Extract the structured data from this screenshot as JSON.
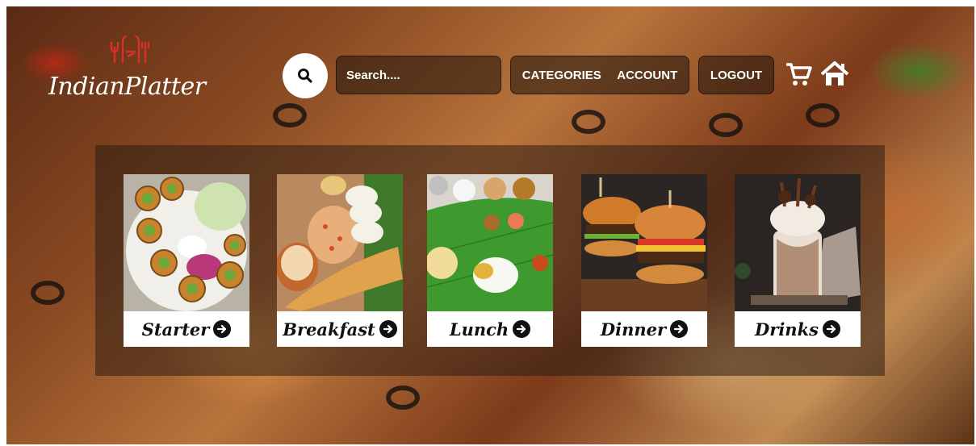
{
  "brand": {
    "name": "IndianPlatter",
    "accent": "#c8312a"
  },
  "search": {
    "placeholder": "Search...."
  },
  "nav": {
    "categories": "CATEGORIES",
    "account": "ACCOUNT",
    "logout": "LOGOUT"
  },
  "icons": {
    "search": "search-icon",
    "cart": "cart-icon",
    "home": "home-icon"
  },
  "categories": [
    {
      "label": "Starter"
    },
    {
      "label": "Breakfast"
    },
    {
      "label": "Lunch"
    },
    {
      "label": "Dinner"
    },
    {
      "label": "Drinks"
    }
  ]
}
